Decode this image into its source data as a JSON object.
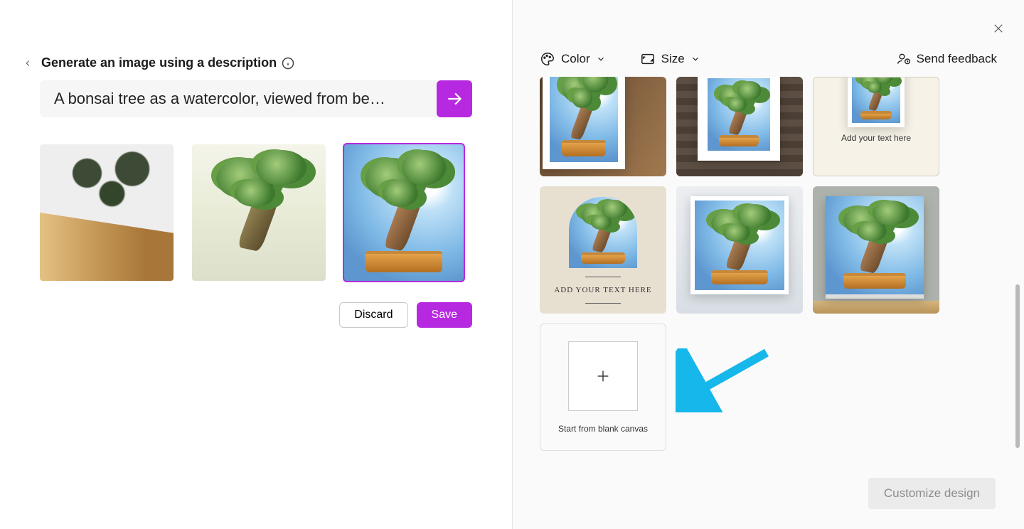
{
  "header": {
    "title": "Generate an image using a description"
  },
  "prompt": {
    "text": "A bonsai tree as a watercolor, viewed from be…"
  },
  "actions": {
    "discard": "Discard",
    "save": "Save"
  },
  "controls": {
    "color": "Color",
    "size": "Size",
    "feedback": "Send feedback"
  },
  "templates": {
    "caption_addtext_small": "Add your text here",
    "caption_addtext_serif": "ADD YOUR TEXT HERE",
    "blank_label": "Start from blank canvas"
  },
  "footer": {
    "customize": "Customize design"
  }
}
